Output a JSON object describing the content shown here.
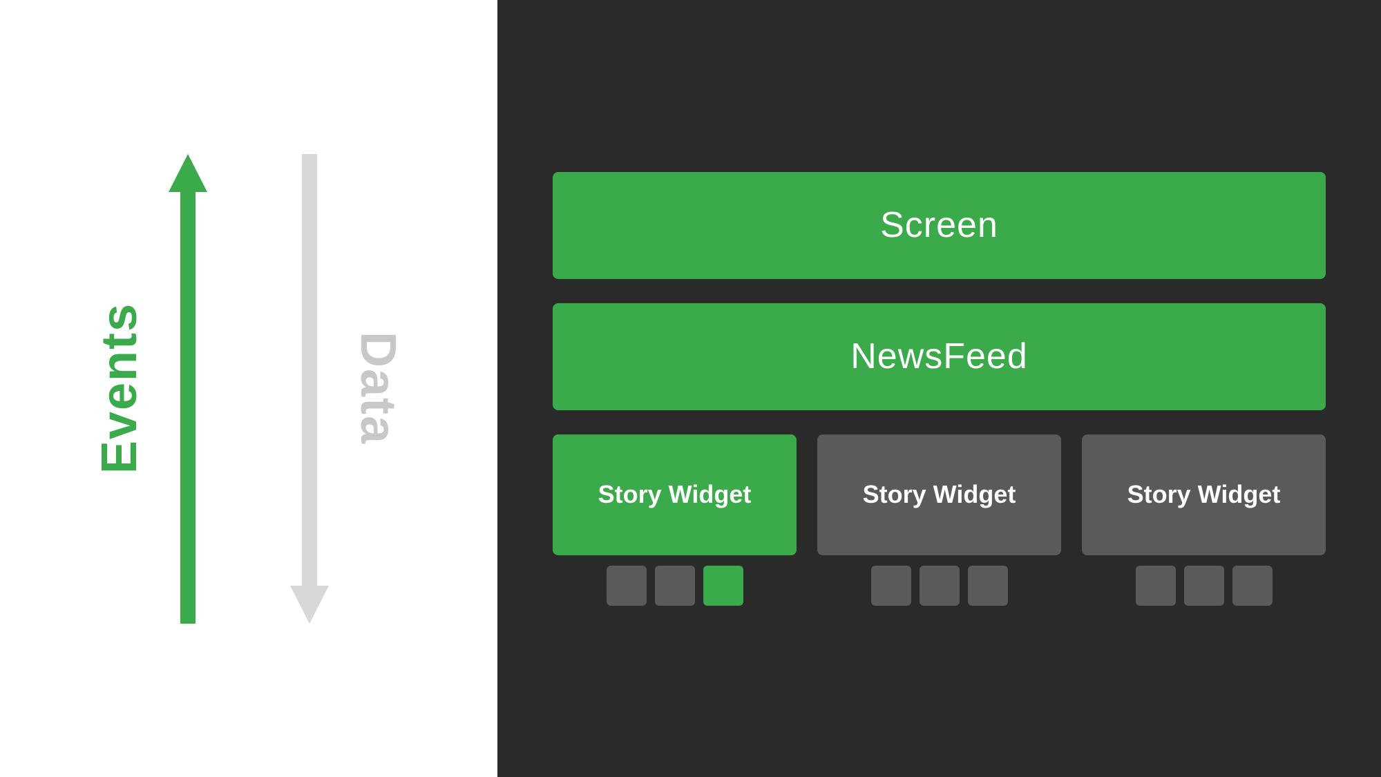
{
  "left_panel": {
    "events_label": "Events",
    "data_label": "Data"
  },
  "right_panel": {
    "screen_label": "Screen",
    "newsfeed_label": "NewsFeed",
    "story_widgets": [
      {
        "label": "Story Widget",
        "color": "green",
        "dots": [
          "gray",
          "gray",
          "green"
        ]
      },
      {
        "label": "Story Widget",
        "color": "gray",
        "dots": [
          "gray",
          "gray",
          "gray"
        ]
      },
      {
        "label": "Story Widget",
        "color": "gray",
        "dots": [
          "gray",
          "gray",
          "gray"
        ]
      }
    ]
  }
}
